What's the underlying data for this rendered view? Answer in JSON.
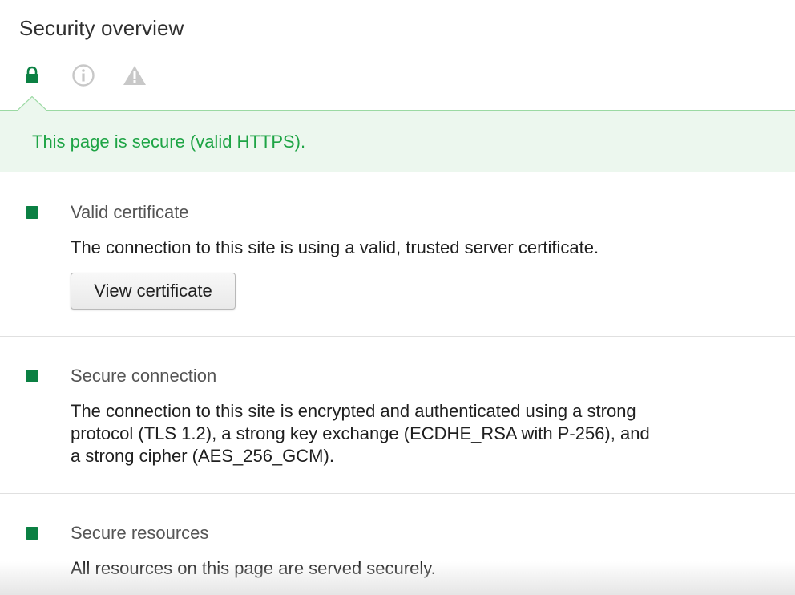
{
  "header": {
    "title": "Security overview"
  },
  "tabs": [
    {
      "icon": "lock-icon",
      "color": "#0b8043",
      "active": true
    },
    {
      "icon": "info-icon",
      "color": "#c8c8c8",
      "active": false
    },
    {
      "icon": "warning-icon",
      "color": "#c8c8c8",
      "active": false
    }
  ],
  "banner": {
    "text": "This page is secure (valid HTTPS).",
    "color": "#1ea445",
    "background": "#ecf7ee"
  },
  "sections": [
    {
      "heading": "Valid certificate",
      "description": "The connection to this site is using a valid, trusted server certificate.",
      "button_label": "View certificate",
      "status_color": "#0b8043"
    },
    {
      "heading": "Secure connection",
      "description_lines": [
        "The connection to this site is encrypted and authenticated using a strong",
        "protocol (TLS 1.2), a strong key exchange (ECDHE_RSA with P-256), and",
        "a strong cipher (AES_256_GCM)."
      ],
      "status_color": "#0b8043"
    },
    {
      "heading": "Secure resources",
      "description": "All resources on this page are served securely.",
      "status_color": "#0b8043"
    }
  ]
}
